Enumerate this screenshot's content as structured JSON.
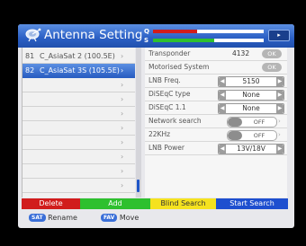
{
  "header": {
    "title": "Antenna Setting",
    "q_label": "Q",
    "s_label": "S",
    "signal": {
      "quality": 0.4,
      "strength": 0.55,
      "quality_color": "#d11c1c",
      "strength_color": "#2ec02e"
    },
    "nav_arrow": "▸"
  },
  "satellites": [
    {
      "num": "81",
      "name": "C_AsiaSat 2 (100.5E)",
      "selected": false
    },
    {
      "num": "82",
      "name": "C_AsiaSat 3S (105.5E)",
      "selected": true
    },
    {
      "num": "",
      "name": "",
      "selected": false
    },
    {
      "num": "",
      "name": "",
      "selected": false
    },
    {
      "num": "",
      "name": "",
      "selected": false
    },
    {
      "num": "",
      "name": "",
      "selected": false
    },
    {
      "num": "",
      "name": "",
      "selected": false
    },
    {
      "num": "",
      "name": "",
      "selected": false
    },
    {
      "num": "",
      "name": "",
      "selected": false
    },
    {
      "num": "",
      "name": "",
      "selected": false
    },
    {
      "num": "",
      "name": "",
      "selected": false
    }
  ],
  "settings": {
    "transponder": {
      "label": "Transponder",
      "value": "4132",
      "button": "OK"
    },
    "motorised": {
      "label": "Motorised System",
      "button": "OK"
    },
    "lnb_freq": {
      "label": "LNB Freq.",
      "value": "5150"
    },
    "diseqc_type": {
      "label": "DiSEqC type",
      "value": "None"
    },
    "diseqc_11": {
      "label": "DiSEqC 1.1",
      "value": "None"
    },
    "network_search": {
      "label": "Network search",
      "value": "OFF"
    },
    "khz22": {
      "label": "22KHz",
      "value": "OFF"
    },
    "lnb_power": {
      "label": "LNB Power",
      "value": "13V/18V"
    }
  },
  "buttons": {
    "delete": "Delete",
    "add": "Add",
    "blind_search": "Blind Search",
    "start_search": "Start Search"
  },
  "legend": {
    "sat_key": "SAT",
    "rename": "Rename",
    "fav_key": "FAV",
    "move": "Move"
  },
  "colors": {
    "header_blue": "#2b5fc4",
    "selection_blue": "#2a5ec2",
    "red": "#d11c1c",
    "green": "#2ec02e",
    "yellow": "#f5e21f",
    "blue": "#1e4fcf"
  }
}
